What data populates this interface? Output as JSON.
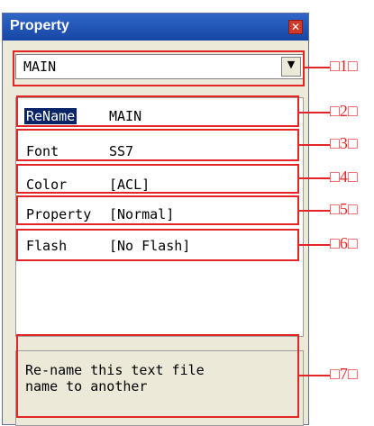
{
  "window": {
    "title": "Property"
  },
  "combo": {
    "value": "MAIN"
  },
  "rows": [
    {
      "name": "ReName",
      "value": "MAIN"
    },
    {
      "name": "Font",
      "value": "SS7"
    },
    {
      "name": "Color",
      "value": "[ACL]"
    },
    {
      "name": "Property",
      "value": "[Normal]"
    },
    {
      "name": "Flash",
      "value": "[No Flash]"
    }
  ],
  "description": "Re-name this text file\nname to another",
  "callouts": [
    "□1□",
    "□2□",
    "□3□",
    "□4□",
    "□5□",
    "□6□",
    "□7□"
  ],
  "colors": {
    "titlebar": "#1f57b7",
    "callout": "#e32525",
    "selection": "#0a246a"
  },
  "icons": {
    "close": "close-icon",
    "dropdown": "chevron-down-icon"
  }
}
